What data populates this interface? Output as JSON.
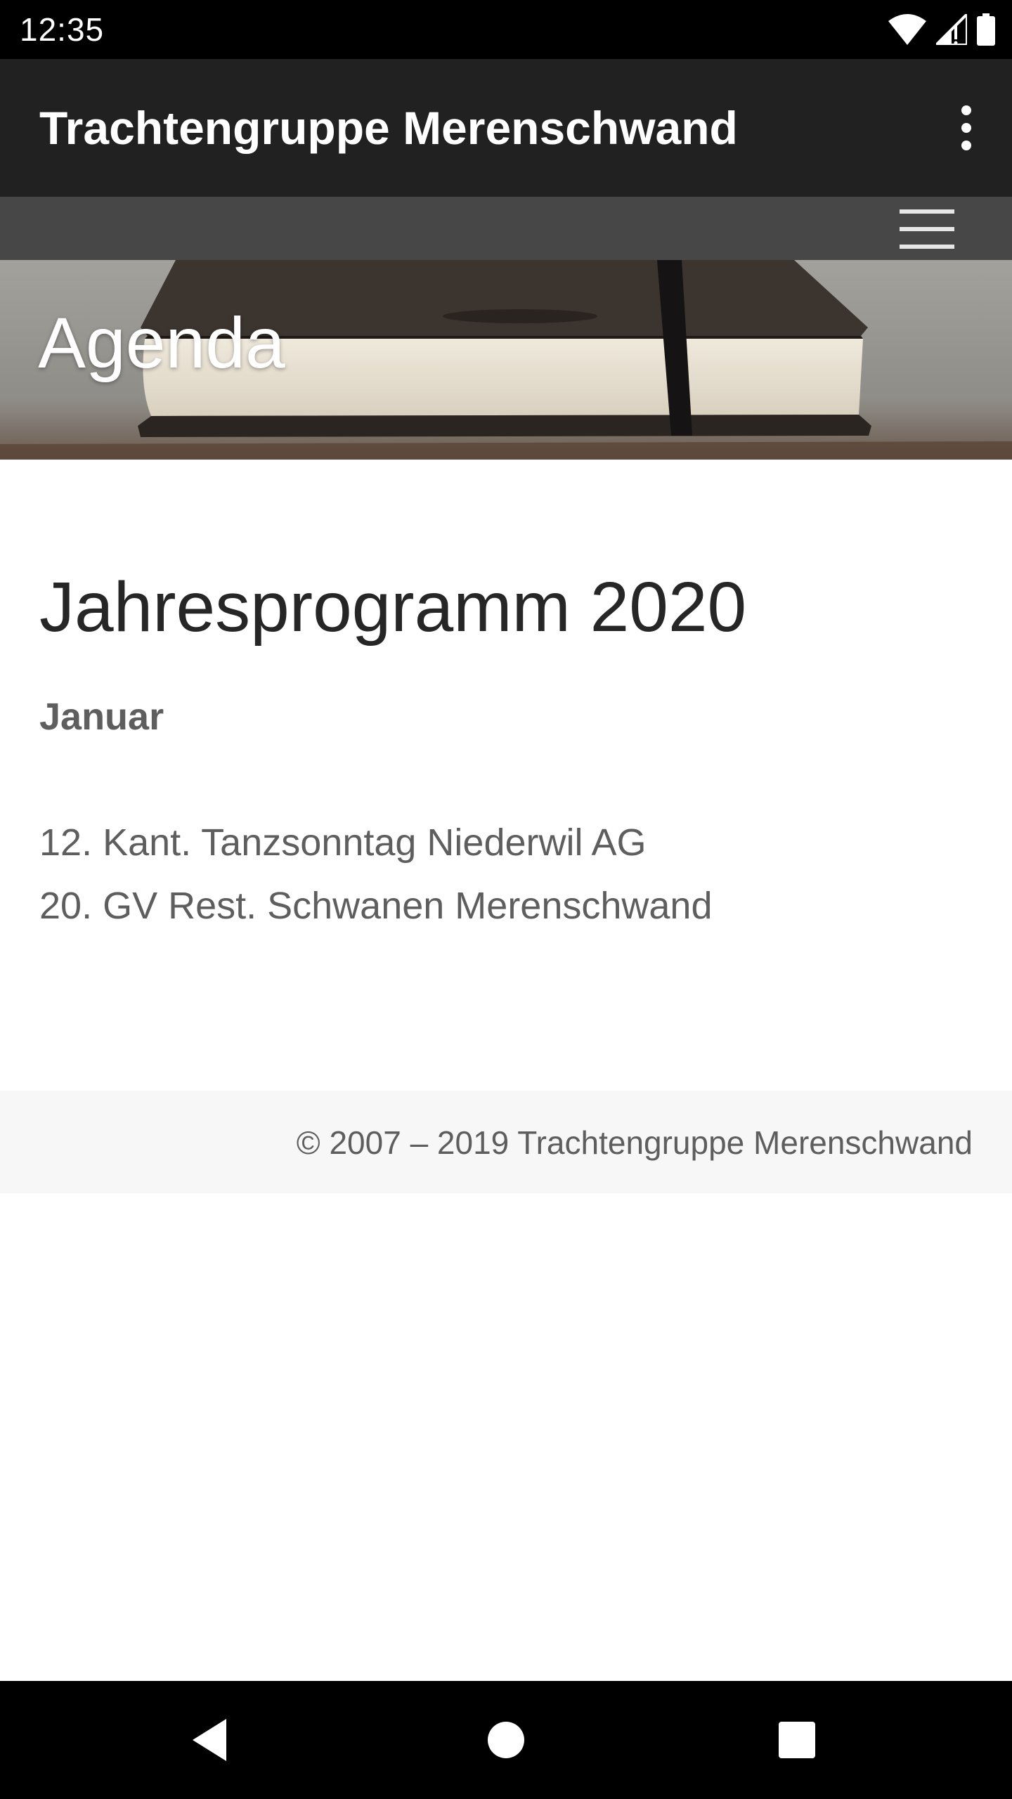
{
  "status_bar": {
    "time": "12:35",
    "icons": [
      "wifi-icon",
      "cellular-signal-icon",
      "battery-icon"
    ]
  },
  "app_bar": {
    "title": "Trachtengruppe Merenschwand",
    "menu_icon": "more-vert-icon"
  },
  "web_nav": {
    "menu_icon": "hamburger-menu-icon"
  },
  "hero": {
    "title": "Agenda"
  },
  "main": {
    "heading": "Jahresprogramm 2020",
    "month": "Januar",
    "events": [
      "12. Kant. Tanzsonntag Niederwil AG",
      "20. GV Rest. Schwanen Merenschwand"
    ]
  },
  "footer": {
    "copyright": "© 2007 – 2019 Trachtengruppe Merenschwand"
  },
  "nav_bar": {
    "icons": [
      "back-icon",
      "home-icon",
      "recents-icon"
    ]
  },
  "colors": {
    "app_bar": "#212121",
    "web_nav": "#474747",
    "footer": "#f7f7f7",
    "heading_text": "#262626",
    "body_text": "#5e5e5e"
  }
}
